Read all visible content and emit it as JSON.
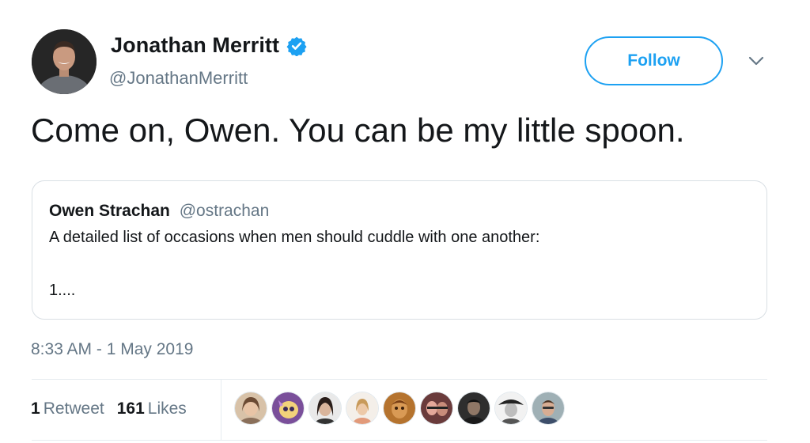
{
  "tweet": {
    "author": {
      "name": "Jonathan Merritt",
      "handle": "@JonathanMerritt",
      "verified": true,
      "avatar_icon": "profile-photo"
    },
    "follow_label": "Follow",
    "menu_icon": "chevron-down-icon",
    "text": "Come on, Owen. You can be my little spoon.",
    "quoted": {
      "name": "Owen Strachan",
      "handle": "@ostrachan",
      "line1": "A detailed list of occasions when men should cuddle with one another:",
      "line2": "1...."
    },
    "timestamp": "8:33 AM - 1 May 2019",
    "stats": {
      "retweets_count": "1",
      "retweets_label": "Retweet",
      "likes_count": "161",
      "likes_label": "Likes"
    },
    "liker_avatars": [
      "liker-avatar-1",
      "liker-avatar-2",
      "liker-avatar-3",
      "liker-avatar-4",
      "liker-avatar-5",
      "liker-avatar-6",
      "liker-avatar-7",
      "liker-avatar-8",
      "liker-avatar-9"
    ]
  },
  "colors": {
    "accent": "#1da1f2",
    "text": "#14171a",
    "muted": "#657786",
    "border": "#e6ecf0"
  }
}
